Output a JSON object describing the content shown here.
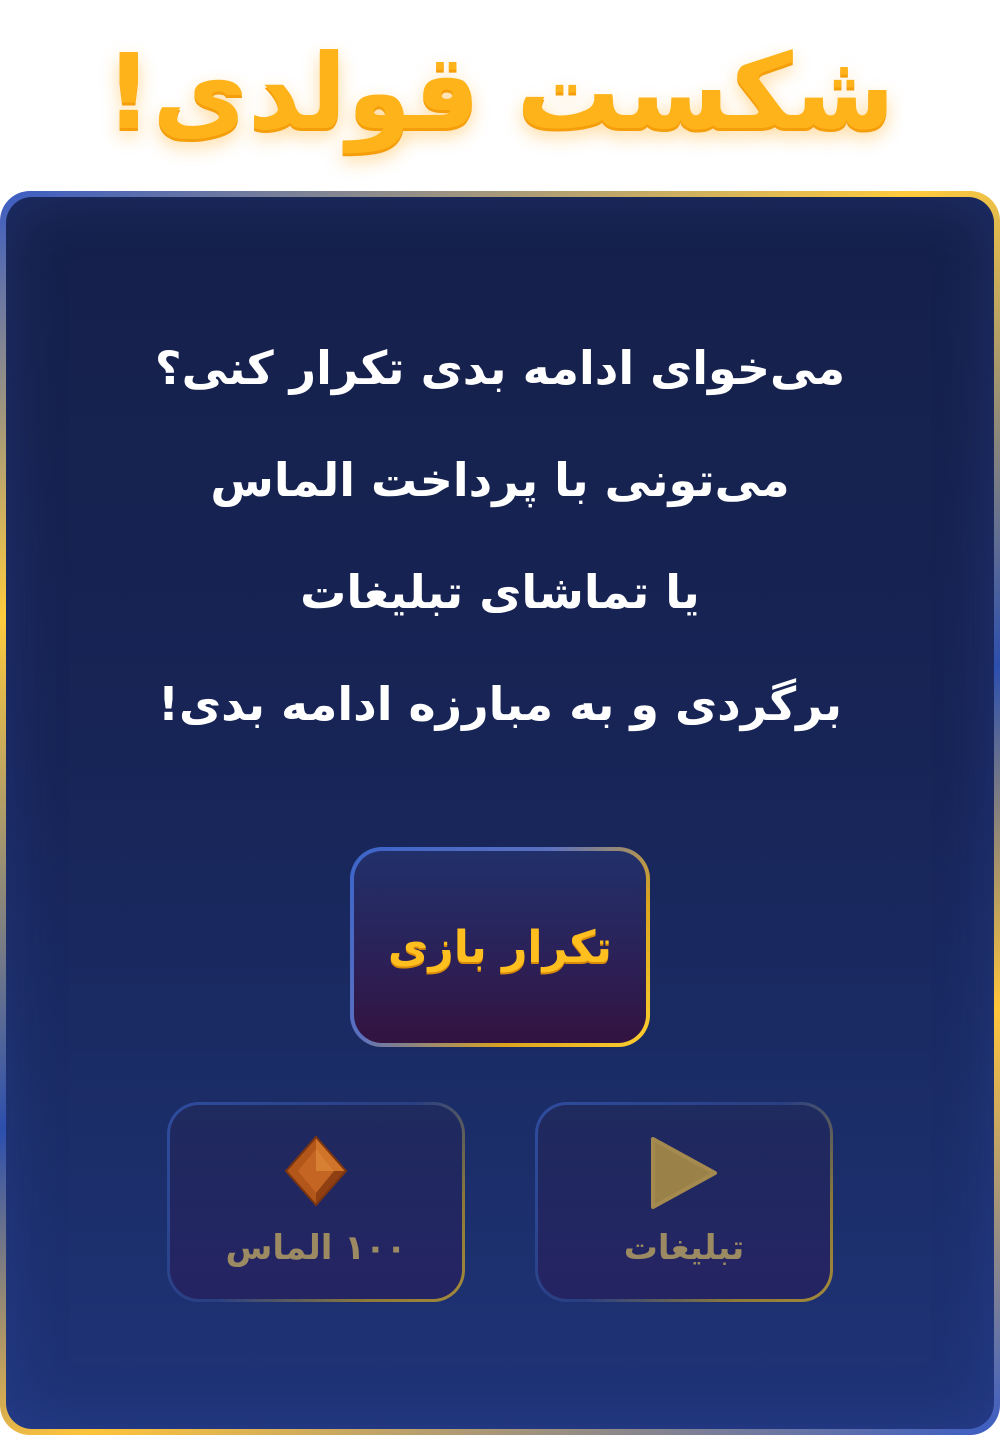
{
  "header": {
    "title": "شکست قولدی!"
  },
  "message": {
    "lines": [
      "می‌خوای ادامه بدی تکرار کنی؟",
      "می‌تونی با پرداخت الماس",
      "یا تماشای تبلیغات",
      "برگردی و به مبارزه ادامه بدی!"
    ]
  },
  "buttons": {
    "replay": {
      "label": "تکرار بازی"
    },
    "diamond": {
      "label": "۱۰۰ الماس",
      "icon": "diamond-icon"
    },
    "ads": {
      "label": "تبلیغات",
      "icon": "play-icon"
    }
  },
  "colors": {
    "title": "#ffb31a",
    "panel": "#172456",
    "replay_label": "#ffbf1f",
    "muted_label": "#9c8a63",
    "diamond": "#c0621e"
  }
}
